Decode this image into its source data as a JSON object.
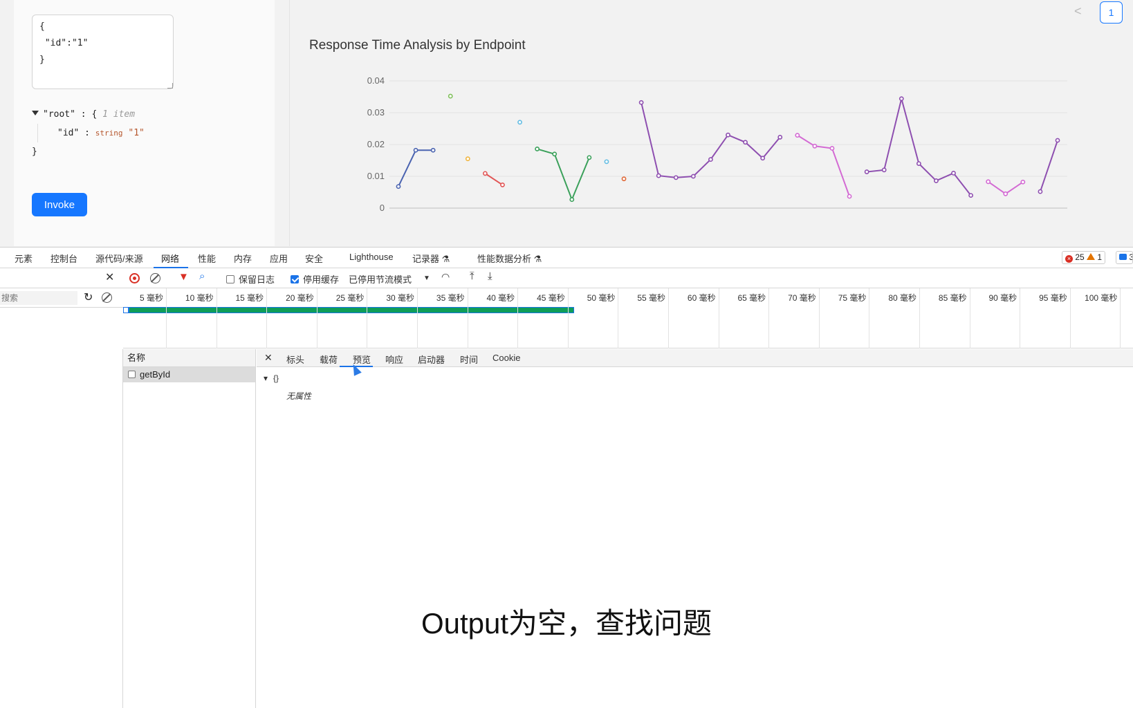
{
  "request": {
    "json_text": "{\n \"id\":\"1\"\n}",
    "tree": {
      "root_key": "\"root\"",
      "root_open": ": {",
      "root_count": "1 item",
      "child_key": "\"id\"",
      "child_sep": ":",
      "child_type": "string",
      "child_value": "\"1\"",
      "close": "}"
    },
    "invoke_label": "Invoke"
  },
  "pagination": {
    "prev": "<",
    "page": "1"
  },
  "chart_data": {
    "type": "line",
    "title": "Response Time Analysis by Endpoint",
    "xlabel": "",
    "ylabel": "",
    "ylim": [
      0,
      0.04
    ],
    "yticks": [
      "0",
      "0.01",
      "0.02",
      "0.03",
      "0.04"
    ],
    "grid": true,
    "legend": "none",
    "series": [
      {
        "color": "#4a63b0",
        "values": [
          0.0068,
          0.0182,
          0.0182
        ]
      },
      {
        "color": "#7fc05a",
        "values": [
          0.0352
        ]
      },
      {
        "color": "#f0b642",
        "values": [
          0.0155
        ]
      },
      {
        "color": "#e25555",
        "values": [
          0.0109,
          0.0073
        ]
      },
      {
        "color": "#64bde3",
        "values": [
          0.027
        ]
      },
      {
        "color": "#3aa05a",
        "values": [
          0.0186,
          0.017,
          0.0027,
          0.0159
        ]
      },
      {
        "color": "#64bde3",
        "values": [
          0.0146
        ]
      },
      {
        "color": "#e06a3a",
        "values": [
          0.0092
        ]
      },
      {
        "color": "#8e4fb0",
        "values": [
          0.0332,
          0.0102,
          0.0096,
          0.01,
          0.0153,
          0.023,
          0.0207,
          0.0157,
          0.0223
        ]
      },
      {
        "color": "#d36ad3",
        "values": [
          0.0229,
          0.0195,
          0.0188,
          0.0037
        ]
      },
      {
        "color": "#8e4fb0",
        "values": [
          0.0114,
          0.012,
          0.0344,
          0.014,
          0.0086,
          0.011,
          0.004
        ]
      },
      {
        "color": "#d36ad3",
        "values": [
          0.0083,
          0.0045,
          0.0082
        ]
      },
      {
        "color": "#8e4fb0",
        "values": [
          0.0052,
          0.0213
        ]
      }
    ]
  },
  "devtools": {
    "tabs": [
      "元素",
      "控制台",
      "源代码/来源",
      "网络",
      "性能",
      "内存",
      "应用",
      "安全",
      "Lighthouse",
      "记录器 ⚗",
      "性能数据分析 ⚗"
    ],
    "error_count": "25",
    "warning_count": "1",
    "message_count": "3",
    "toolbar": {
      "preserve_log": "保留日志",
      "disable_cache": "停用缓存",
      "throttle": "已停用节流模式"
    },
    "search_placeholder": "搜索",
    "timeline_ticks": [
      "5 毫秒",
      "10 毫秒",
      "15 毫秒",
      "20 毫秒",
      "25 毫秒",
      "30 毫秒",
      "35 毫秒",
      "40 毫秒",
      "45 毫秒",
      "50 毫秒",
      "55 毫秒",
      "60 毫秒",
      "65 毫秒",
      "70 毫秒",
      "75 毫秒",
      "80 毫秒",
      "85 毫秒",
      "90 毫秒",
      "95 毫秒",
      "100 毫秒"
    ],
    "name_header": "名称",
    "request_name": "getById",
    "detail_tabs": [
      "标头",
      "载荷",
      "预览",
      "响应",
      "启动器",
      "时间",
      "Cookie"
    ],
    "preview": {
      "root": "{}",
      "empty": "无属性"
    }
  },
  "caption": "Output为空，查找问题"
}
